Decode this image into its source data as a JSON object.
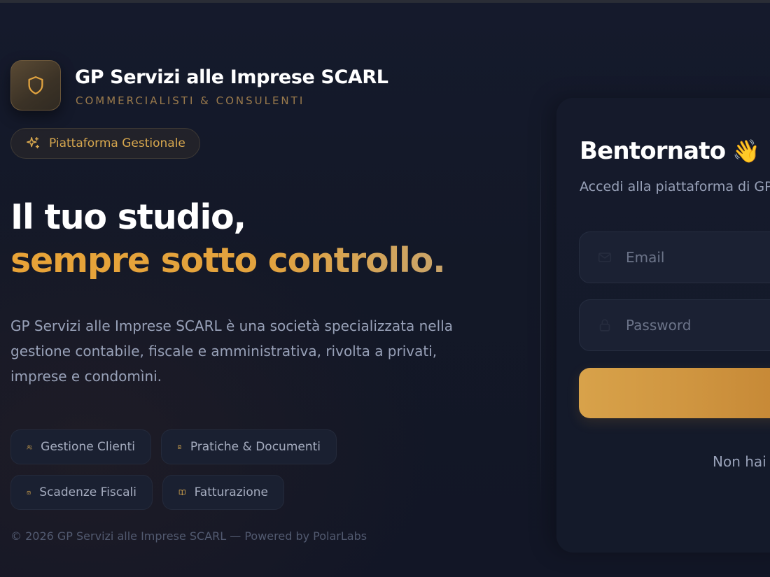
{
  "brand": {
    "name": "GP Servizi alle Imprese SCARL",
    "tagline": "COMMERCIALISTI & CONSULENTI",
    "logo_icon": "shield-icon"
  },
  "badge": {
    "label": "Piattaforma Gestionale",
    "icon": "sparkles-icon"
  },
  "hero": {
    "headline_line1": "Il tuo studio,",
    "headline_line2": "sempre sotto controllo.",
    "description": "GP Servizi alle Imprese SCARL è una società specializzata nella gestione contabile, fiscale e amministrativa, rivolta a privati, imprese e condomìni."
  },
  "features": [
    {
      "label": "Gestione Clienti",
      "icon": "users-icon"
    },
    {
      "label": "Pratiche & Documenti",
      "icon": "file-text-icon"
    },
    {
      "label": "Scadenze Fiscali",
      "icon": "calendar-check-icon"
    },
    {
      "label": "Fatturazione",
      "icon": "book-open-icon"
    }
  ],
  "footer": {
    "text": "© 2026 GP Servizi alle Imprese SCARL — Powered by PolarLabs"
  },
  "login": {
    "title": "Bentornato",
    "wave": "👋",
    "subtitle": "Accedi alla piattaforma di GP S",
    "email_placeholder": "Email",
    "password_placeholder": "Password",
    "signup_prompt": "Non hai u"
  },
  "colors": {
    "accent": "#e0a23a",
    "background": "#131827",
    "text_muted": "#98a1b8"
  }
}
